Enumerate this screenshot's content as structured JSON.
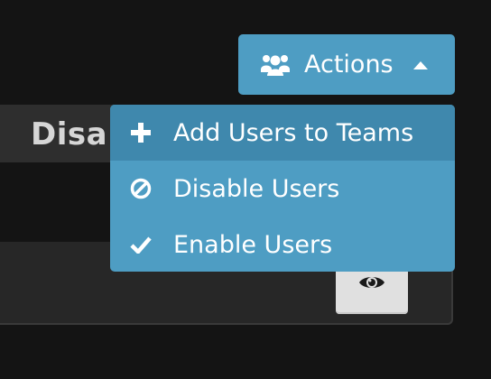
{
  "background": {
    "heading_fragment": "Disa",
    "view_button_icon": "eye-icon"
  },
  "actions_button": {
    "label": "Actions",
    "icon": "users-icon",
    "caret": "caret-up-icon"
  },
  "actions_menu": {
    "items": [
      {
        "label": "Add Users to Teams",
        "icon": "plus-icon",
        "active": true
      },
      {
        "label": "Disable Users",
        "icon": "ban-icon",
        "active": false
      },
      {
        "label": "Enable Users",
        "icon": "check-icon",
        "active": false
      }
    ]
  },
  "colors": {
    "accent": "#4e9dc3",
    "accent_active": "#3f88ad",
    "page_bg": "#141414"
  }
}
